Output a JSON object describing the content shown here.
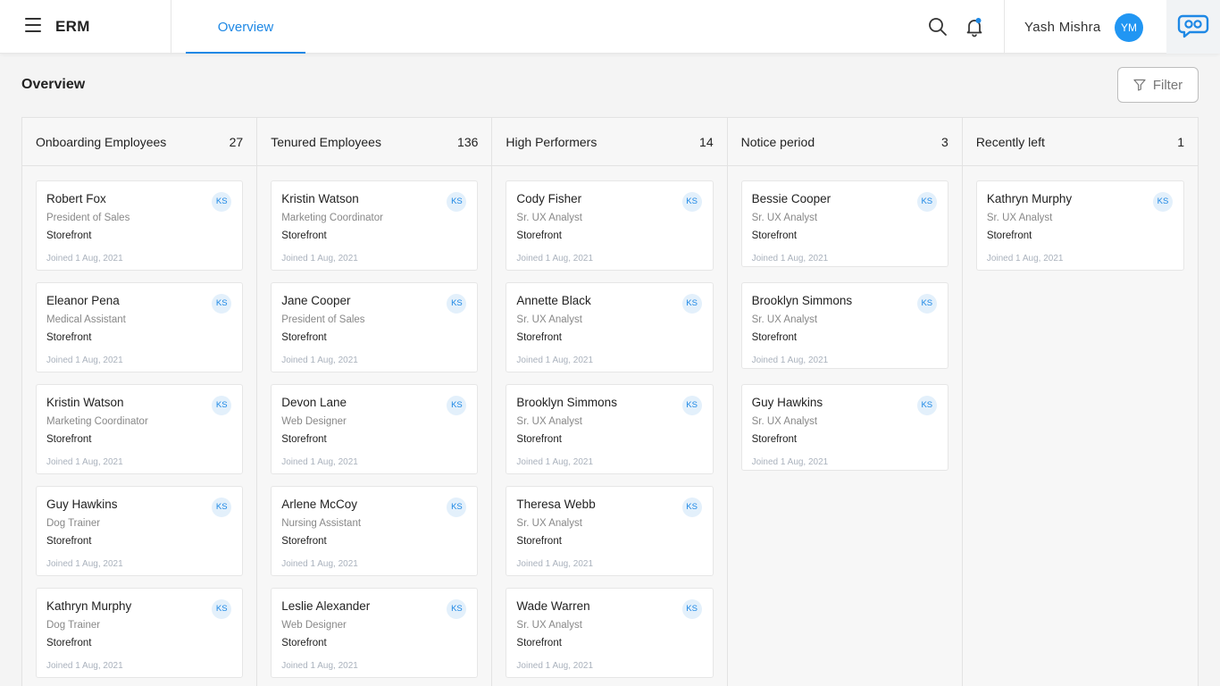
{
  "app": {
    "title": "ERM",
    "menu_icon": "hamburger-menu-icon"
  },
  "nav": {
    "active_tab": "Overview"
  },
  "header": {
    "user_name": "Yash Mishra",
    "user_initials": "YM",
    "search_icon": "search-icon",
    "bell_icon": "notification-bell-icon",
    "brand_icon": "chat-logo-icon",
    "accent": "#1e88e5"
  },
  "page": {
    "title": "Overview",
    "filter_label": "Filter"
  },
  "columns": [
    {
      "title": "Onboarding Employees",
      "count": "27",
      "cards": [
        {
          "name": "Robert Fox",
          "role": "President of Sales",
          "store": "Storefront",
          "joined": "Joined 1 Aug, 2021",
          "badge": "KS"
        },
        {
          "name": "Eleanor Pena",
          "role": "Medical Assistant",
          "store": "Storefront",
          "joined": "Joined 1 Aug, 2021",
          "badge": "KS"
        },
        {
          "name": "Kristin Watson",
          "role": "Marketing Coordinator",
          "store": "Storefront",
          "joined": "Joined 1 Aug, 2021",
          "badge": "KS"
        },
        {
          "name": "Guy Hawkins",
          "role": "Dog Trainer",
          "store": "Storefront",
          "joined": "Joined 1 Aug, 2021",
          "badge": "KS"
        },
        {
          "name": "Kathryn Murphy",
          "role": "Dog Trainer",
          "store": "Storefront",
          "joined": "Joined 1 Aug, 2021",
          "badge": "KS"
        }
      ]
    },
    {
      "title": "Tenured Employees",
      "count": "136",
      "cards": [
        {
          "name": "Kristin Watson",
          "role": "Marketing Coordinator",
          "store": "Storefront",
          "joined": "Joined 1 Aug, 2021",
          "badge": "KS"
        },
        {
          "name": "Jane Cooper",
          "role": "President of Sales",
          "store": "Storefront",
          "joined": "Joined 1 Aug, 2021",
          "badge": "KS"
        },
        {
          "name": "Devon Lane",
          "role": "Web Designer",
          "store": "Storefront",
          "joined": "Joined 1 Aug, 2021",
          "badge": "KS"
        },
        {
          "name": "Arlene McCoy",
          "role": "Nursing Assistant",
          "store": "Storefront",
          "joined": "Joined 1 Aug, 2021",
          "badge": "KS"
        },
        {
          "name": "Leslie Alexander",
          "role": "Web Designer",
          "store": "Storefront",
          "joined": "Joined 1 Aug, 2021",
          "badge": "KS"
        }
      ]
    },
    {
      "title": "High Performers",
      "count": "14",
      "cards": [
        {
          "name": "Cody Fisher",
          "role": "Sr. UX Analyst",
          "store": "Storefront",
          "joined": "Joined 1 Aug, 2021",
          "badge": "KS"
        },
        {
          "name": "Annette Black",
          "role": "Sr. UX Analyst",
          "store": "Storefront",
          "joined": "Joined 1 Aug, 2021",
          "badge": "KS"
        },
        {
          "name": "Brooklyn Simmons",
          "role": "Sr. UX Analyst",
          "store": "Storefront",
          "joined": "Joined 1 Aug, 2021",
          "badge": "KS"
        },
        {
          "name": "Theresa Webb",
          "role": "Sr. UX Analyst",
          "store": "Storefront",
          "joined": "Joined 1 Aug, 2021",
          "badge": "KS"
        },
        {
          "name": "Wade Warren",
          "role": "Sr. UX Analyst",
          "store": "Storefront",
          "joined": "Joined 1 Aug, 2021",
          "badge": "KS"
        }
      ]
    },
    {
      "title": "Notice period",
      "count": "3",
      "cards": [
        {
          "name": "Bessie Cooper",
          "role": "Sr. UX Analyst",
          "store": "Storefront",
          "joined": "Joined 1 Aug, 2021",
          "badge": "KS"
        },
        {
          "name": "Brooklyn Simmons",
          "role": "Sr. UX Analyst",
          "store": "Storefront",
          "joined": "Joined 1 Aug, 2021",
          "badge": "KS"
        },
        {
          "name": "Guy Hawkins",
          "role": "Sr. UX Analyst",
          "store": "Storefront",
          "joined": "Joined 1 Aug, 2021",
          "badge": "KS"
        }
      ]
    },
    {
      "title": "Recently left",
      "count": "1",
      "cards": [
        {
          "name": "Kathryn Murphy",
          "role": "Sr. UX Analyst",
          "store": "Storefront",
          "joined": "Joined 1 Aug, 2021",
          "badge": "KS"
        }
      ]
    }
  ]
}
